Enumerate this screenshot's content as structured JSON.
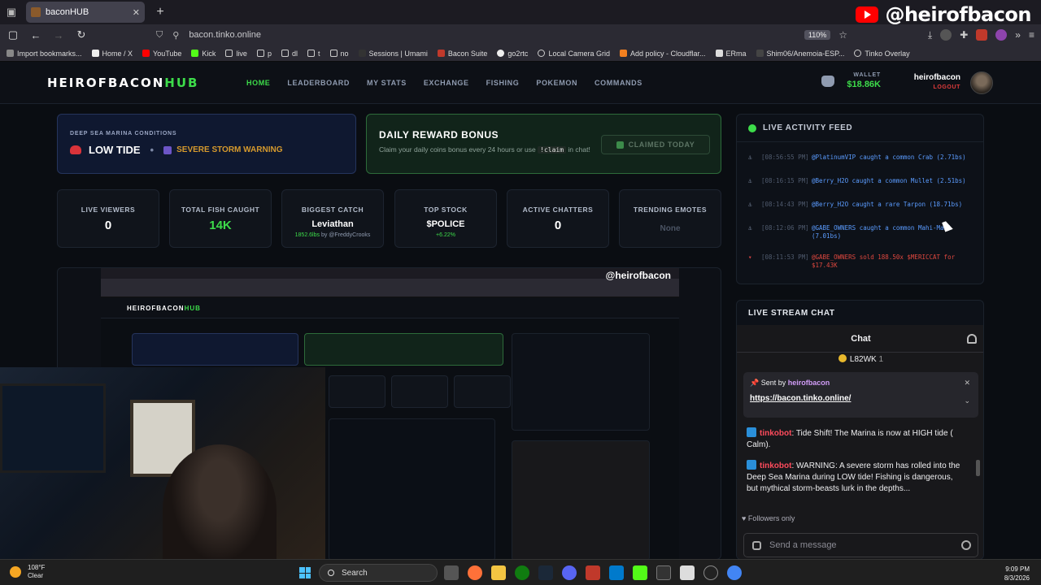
{
  "browser": {
    "tab_title": "baconHUB",
    "url": "bacon.tinko.online",
    "zoom": "110%",
    "overlay_handle": "@heirofbacon",
    "bookmarks": [
      "Import bookmarks...",
      "Home / X",
      "YouTube",
      "Kick",
      "live",
      "p",
      "dl",
      "t",
      "no",
      "Sessions | Umami",
      "Bacon Suite",
      "go2rtc",
      "Local Camera Grid",
      "Add policy - Cloudflar...",
      "ERma",
      "Shim06/Anemoia-ESP...",
      "Tinko Overlay"
    ]
  },
  "site": {
    "brand_main": "HEIROFBACON",
    "brand_hub": "HUB",
    "nav": [
      "HOME",
      "LEADERBOARD",
      "MY STATS",
      "EXCHANGE",
      "FISHING",
      "POKEMON",
      "COMMANDS"
    ],
    "wallet_label": "WALLET",
    "wallet_amount": "$18.86K",
    "username": "heirofbacon",
    "logout": "LOGOUT"
  },
  "marina": {
    "label": "DEEP SEA MARINA CONDITIONS",
    "tide": "LOW TIDE",
    "separator": "•",
    "warning": "SEVERE STORM WARNING"
  },
  "reward": {
    "title": "DAILY REWARD BONUS",
    "desc_before": "Claim your daily coins bonus every 24 hours or use",
    "command": "!claim",
    "desc_after": "in chat!",
    "claimed": "CLAIMED TODAY"
  },
  "stats": [
    {
      "label": "LIVE VIEWERS",
      "value": "0"
    },
    {
      "label": "TOTAL FISH CAUGHT",
      "value": "14K"
    },
    {
      "label": "BIGGEST CATCH",
      "value": "Leviathan",
      "sub_weight": "1852.6lbs",
      "sub_by": "by @FreddyCrooks"
    },
    {
      "label": "TOP STOCK",
      "value": "$POLICE",
      "sub": "+6.22%"
    },
    {
      "label": "ACTIVE CHATTERS",
      "value": "0"
    },
    {
      "label": "TRENDING EMOTES",
      "value": "None"
    }
  ],
  "activity": {
    "title": "LIVE ACTIVITY FEED",
    "items": [
      {
        "time": "[08:56:55 PM]",
        "text": "@PlatinumVIP caught a common Crab (2.71bs)",
        "kind": "fish"
      },
      {
        "time": "[08:16:15 PM]",
        "text": "@Berry_H2O caught a common Mullet (2.51bs)",
        "kind": "fish"
      },
      {
        "time": "[08:14:43 PM]",
        "text": "@Berry_H2O caught a rare Tarpon (18.71bs)",
        "kind": "fish"
      },
      {
        "time": "[08:12:06 PM]",
        "text": "@GABE_OWNERS caught a common Mahi-Mahi (7.01bs)",
        "kind": "fish"
      },
      {
        "time": "[08:11:53 PM]",
        "text": "@GABE_OWNERS sold 188.50x $MERICCAT for $17.43K",
        "kind": "sell"
      }
    ]
  },
  "stream_chat": {
    "title": "LIVE STREAM CHAT",
    "chat_header": "Chat",
    "pinned_top": "L82WK",
    "pinned_top_count": "1",
    "pinned_by_prefix": "Sent by",
    "pinned_by": "heirofbacon",
    "pinned_link": "https://bacon.tinko.online/",
    "messages": [
      {
        "user": "tinkobot",
        "text": ": Tide Shift! The Marina is now at HIGH tide ( Calm)."
      },
      {
        "user": "tinkobot",
        "text": ": WARNING: A severe storm has rolled into the Deep Sea Marina during LOW tide! Fishing is dangerous, but mythical storm-beasts lurk in the depths..."
      }
    ],
    "followers_only": "Followers only",
    "input_placeholder": "Send a message"
  },
  "embedded": {
    "brand_main": "HEIROFBACON",
    "brand_hub": "HUB",
    "handle": "@heirofbacon"
  },
  "taskbar": {
    "temp": "108°F",
    "condition": "Clear",
    "search": "Search",
    "time": "9:09 PM",
    "date": "8/3/2026"
  }
}
